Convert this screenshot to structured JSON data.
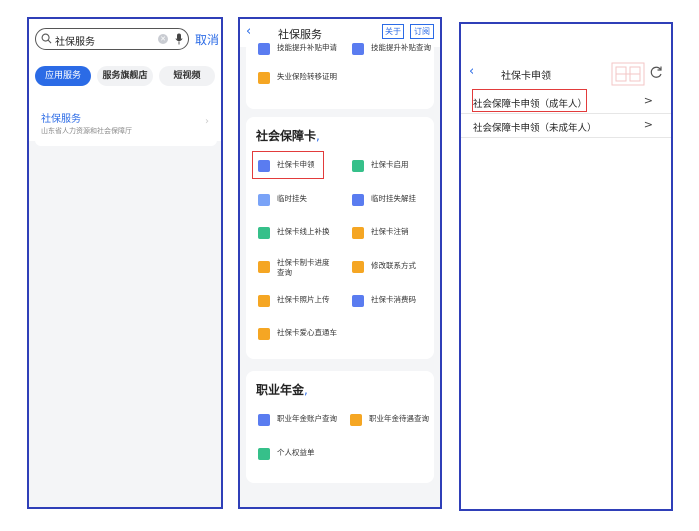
{
  "screen1": {
    "search": {
      "query": "社保服务",
      "cancel_label": "取消"
    },
    "tabs": [
      {
        "label": "应用服务",
        "active": true
      },
      {
        "label": "服务旗舰店",
        "active": false
      },
      {
        "label": "短视频",
        "active": false
      }
    ],
    "result": {
      "title": "社保服务",
      "subtitle": "山东省人力资源和社会保障厅"
    }
  },
  "screen2": {
    "title": "社保服务",
    "header_buttons": {
      "about": "关于",
      "subscribe": "订阅"
    },
    "top_partial": {
      "left": "技能提升补贴申请",
      "right": "技能提升补贴查询"
    },
    "top_card_item": "失业保险转移证明",
    "social_card": {
      "title": "社会保障卡",
      "items": [
        {
          "label": "社保卡申领",
          "icon": "card-icon",
          "color": "#5a7cf0"
        },
        {
          "label": "社保卡启用",
          "icon": "card-icon",
          "color": "#36c08a"
        },
        {
          "label": "临时挂失",
          "icon": "card-icon",
          "color": "#5a7cf0"
        },
        {
          "label": "临时挂失解挂",
          "icon": "card-icon",
          "color": "#5a7cf0"
        },
        {
          "label": "社保卡线上补换",
          "icon": "card-icon",
          "color": "#36c08a"
        },
        {
          "label": "社保卡注销",
          "icon": "card-icon",
          "color": "#f5a623"
        },
        {
          "label": "社保卡制卡进度查询",
          "icon": "card-icon",
          "color": "#f5a623"
        },
        {
          "label": "修改联系方式",
          "icon": "card-icon",
          "color": "#f5a623"
        },
        {
          "label": "社保卡照片上传",
          "icon": "photo-icon",
          "color": "#f5a623"
        },
        {
          "label": "社保卡消费码",
          "icon": "code-icon",
          "color": "#5a7cf0"
        },
        {
          "label": "社保卡爱心直通车",
          "icon": "card-icon",
          "color": "#f5a623"
        }
      ]
    },
    "annuity": {
      "title": "职业年金",
      "items": [
        {
          "label": "职业年金账户查询",
          "icon": "account-icon",
          "color": "#5a7cf0"
        },
        {
          "label": "职业年金待遇查询",
          "icon": "account-icon",
          "color": "#f5a623"
        },
        {
          "label": "个人权益单",
          "icon": "person-icon",
          "color": "#36c08a"
        }
      ]
    }
  },
  "screen3": {
    "title": "社保卡申领",
    "rows": [
      {
        "label": "社会保障卡申领（成年人）"
      },
      {
        "label": "社会保障卡申领（未成年人）"
      }
    ]
  },
  "colors": {
    "accent": "#2b6be6",
    "highlight": "#e23b3b",
    "frame": "#2f3fb8"
  }
}
